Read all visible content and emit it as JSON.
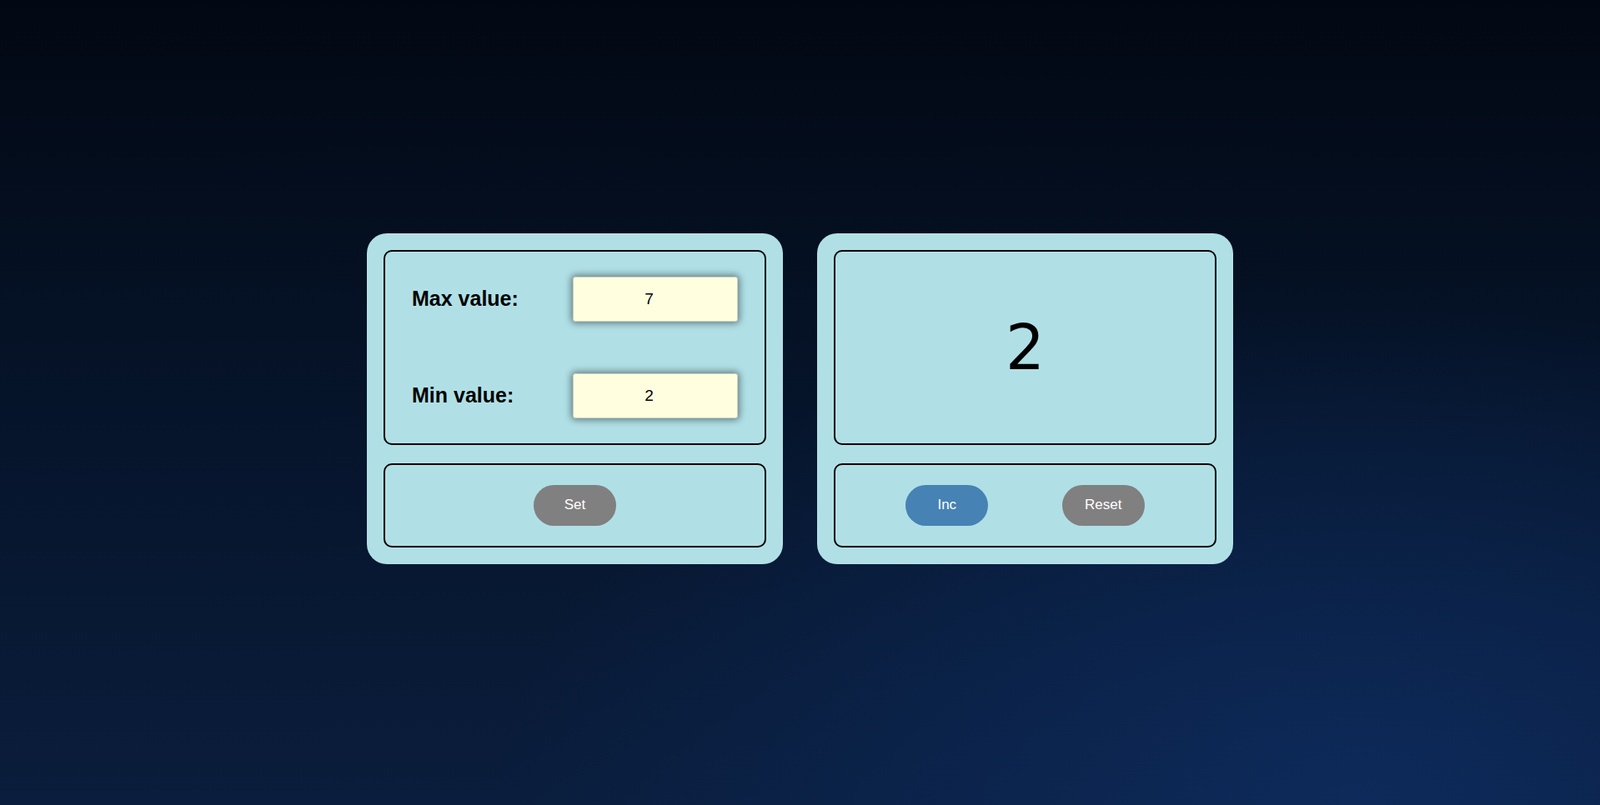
{
  "settings": {
    "fields": [
      {
        "label": "Max value:",
        "value": "7"
      },
      {
        "label": "Min value:",
        "value": "2"
      }
    ],
    "set_button": {
      "label": "Set",
      "disabled": true
    }
  },
  "counter": {
    "value": "2",
    "buttons": [
      {
        "label": "Inc",
        "disabled": false
      },
      {
        "label": "Reset",
        "disabled": true
      }
    ]
  }
}
